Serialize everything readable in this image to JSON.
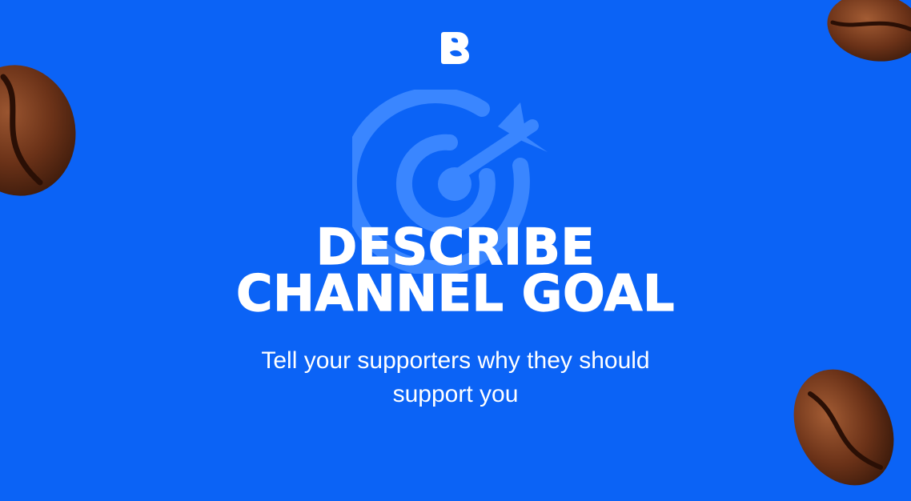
{
  "brand": {
    "logo_icon": "brand-b-leaf-logo"
  },
  "headline": {
    "line1": "DESCRIBE",
    "line2": "CHANNEL GOAL"
  },
  "subtitle": {
    "line1": "Tell your supporters why they should",
    "line2": "support you"
  },
  "decor": {
    "target_icon": "target-arrow-icon",
    "beans": [
      "coffee-bean-icon",
      "coffee-bean-icon",
      "coffee-bean-icon"
    ]
  },
  "colors": {
    "background": "#0b63f6",
    "text": "#ffffff",
    "target_tint": "#3a86ff",
    "bean_dark": "#4a2512",
    "bean_mid": "#7a3f1f"
  }
}
